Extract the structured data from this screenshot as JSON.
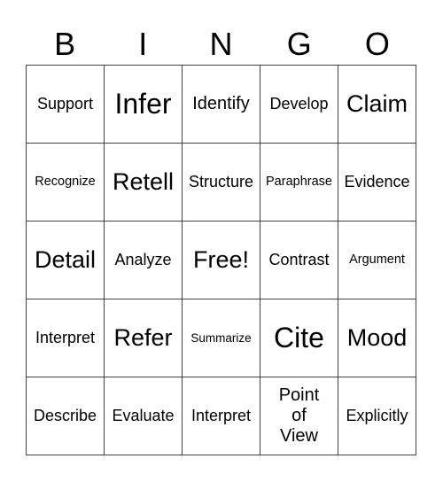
{
  "header": [
    "B",
    "I",
    "N",
    "G",
    "O"
  ],
  "rows": [
    [
      "Support",
      "Infer",
      "Identify",
      "Develop",
      "Claim"
    ],
    [
      "Recognize",
      "Retell",
      "Structure",
      "Paraphrase",
      "Evidence"
    ],
    [
      "Detail",
      "Analyze",
      "Free!",
      "Contrast",
      "Argument"
    ],
    [
      "Interpret",
      "Refer",
      "Summarize",
      "Cite",
      "Mood"
    ],
    [
      "Describe",
      "Evaluate",
      "Interpret",
      "Point of View",
      "Explicitly"
    ]
  ]
}
